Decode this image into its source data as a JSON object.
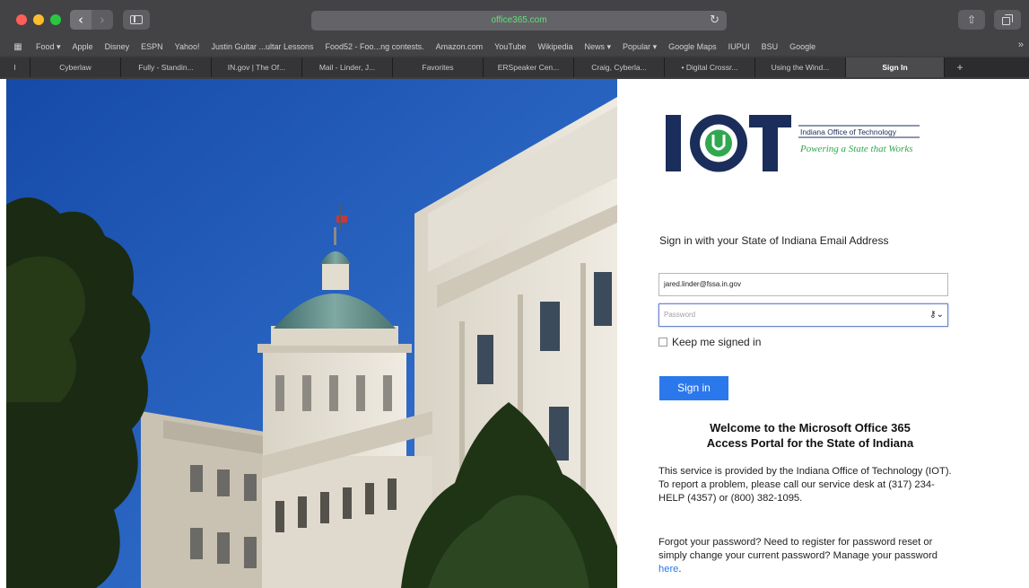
{
  "browser": {
    "address": "office365.com",
    "bookmarks": [
      "Food ▾",
      "Apple",
      "Disney",
      "ESPN",
      "Yahoo!",
      "Justin Guitar ...ultar Lessons",
      "Food52 - Foo...ng contests.",
      "Amazon.com",
      "YouTube",
      "Wikipedia",
      "News ▾",
      "Popular ▾",
      "Google Maps",
      "IUPUI",
      "BSU",
      "Google"
    ],
    "tabs": [
      "I",
      "Cyberlaw",
      "Fully - Standin...",
      "IN.gov | The Of...",
      "Mail - Linder, J...",
      "Favorites",
      "ERSpeaker Cen...",
      "Craig, Cyberla...",
      "• Digital Crossr...",
      "Using the Wind...",
      "Sign In"
    ],
    "active_tab": "Sign In"
  },
  "logo": {
    "letters": "IOT",
    "org_name": "Indiana Office of Technology",
    "tagline": "Powering a State that Works"
  },
  "signin": {
    "heading": "Sign in with your State of Indiana Email Address",
    "email_value": "jared.linder@fssa.in.gov",
    "password_placeholder": "Password",
    "keep_signed_in": "Keep me signed in",
    "button": "Sign in"
  },
  "welcome": {
    "line1": "Welcome to the Microsoft Office 365",
    "line2": "Access Portal for the State of Indiana"
  },
  "info": {
    "service": "This service is provided by the Indiana Office of Technology (IOT). To report a problem, please call our service desk at (317) 234-HELP (4357) or (800) 382-1095.",
    "forgot_prefix": "Forgot your password? Need to register for password reset or simply change your current password? Manage your password ",
    "forgot_link": "here",
    "forgot_suffix": "."
  },
  "colors": {
    "button_blue": "#2b78ec",
    "iot_navy": "#1b2d5a",
    "iot_green": "#2fa84f",
    "sky": "#1f54b8"
  }
}
